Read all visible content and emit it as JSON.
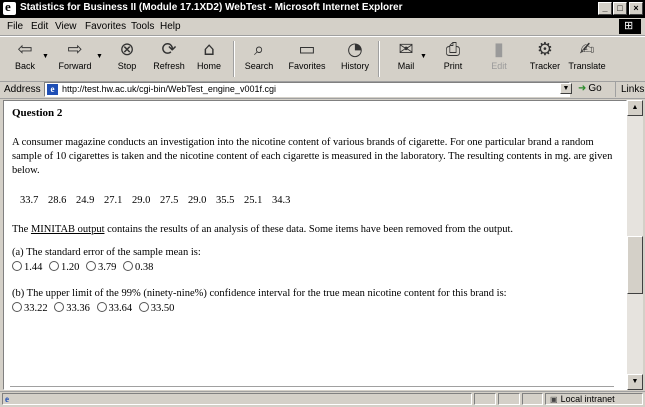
{
  "window": {
    "title": "Statistics for Business II (Module 17.1XD2) WebTest - Microsoft Internet Explorer",
    "controls": [
      "_",
      "□",
      "×"
    ]
  },
  "menu": [
    "File",
    "Edit",
    "View",
    "Favorites",
    "Tools",
    "Help"
  ],
  "toolbar": {
    "buttons": [
      {
        "label": "Back",
        "icon": "back-arrow-icon",
        "glyph": "⇦"
      },
      {
        "label": "Forward",
        "icon": "forward-arrow-icon",
        "glyph": "⇨"
      },
      {
        "label": "Stop",
        "icon": "stop-icon",
        "glyph": "⊗"
      },
      {
        "label": "Refresh",
        "icon": "refresh-icon",
        "glyph": "⟳"
      },
      {
        "label": "Home",
        "icon": "home-icon",
        "glyph": "⌂"
      },
      {
        "label": "Search",
        "icon": "search-icon",
        "glyph": "⌕"
      },
      {
        "label": "Favorites",
        "icon": "favorites-folder-icon",
        "glyph": "▭"
      },
      {
        "label": "History",
        "icon": "history-icon",
        "glyph": "◔"
      },
      {
        "label": "Mail",
        "icon": "mail-icon",
        "glyph": "✉"
      },
      {
        "label": "Print",
        "icon": "print-icon",
        "glyph": "⎙"
      },
      {
        "label": "Edit",
        "icon": "edit-icon",
        "glyph": "▮"
      },
      {
        "label": "Tracker",
        "icon": "tracker-icon",
        "glyph": "⚙"
      },
      {
        "label": "Translate",
        "icon": "translate-icon",
        "glyph": "✍"
      }
    ]
  },
  "address": {
    "label": "Address",
    "url": "http://test.hw.ac.uk/cgi-bin/WebTest_engine_v001f.cgi",
    "go_label": "Go",
    "links_label": "Links"
  },
  "page": {
    "question_title": "Question 2",
    "intro": "A consumer magazine conducts an investigation into the nicotine content of various brands of cigarette. For one particular brand a random sample of 10 cigarettes is taken and the nicotine content of each cigarette is measured in the laboratory. The resulting contents in mg. are given below.",
    "data_values": [
      "33.7",
      "28.6",
      "24.9",
      "27.1",
      "29.0",
      "27.5",
      "29.0",
      "35.5",
      "25.1",
      "34.3"
    ],
    "minitab_prefix": "The ",
    "minitab_link": "MINITAB output",
    "minitab_suffix": " contains the results of an analysis of these data. Some items have been removed from the output.",
    "part_a": {
      "question": "(a) The standard error of the sample mean is:",
      "options": [
        "1.44",
        "1.20",
        "3.79",
        "0.38"
      ]
    },
    "part_b": {
      "question": "(b) The upper limit of the 99% (ninety-nine%) confidence interval for the true mean nicotine content for this brand is:",
      "options": [
        "33.22",
        "33.36",
        "33.64",
        "33.50"
      ]
    }
  },
  "status": {
    "zone": "Local intranet"
  }
}
